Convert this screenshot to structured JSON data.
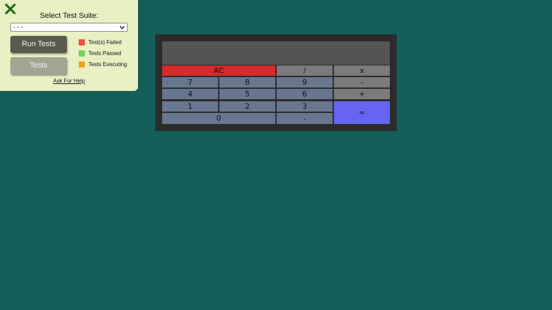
{
  "test_panel": {
    "title": "Select Test Suite:",
    "suite_select": {
      "value": "- - -"
    },
    "run_tests_label": "Run Tests",
    "tests_label": "Tests",
    "legend": [
      {
        "label": "Test(s) Failed",
        "color": "#ee5441"
      },
      {
        "label": "Tests Passed",
        "color": "#6fd45a"
      },
      {
        "label": "Tests Executing",
        "color": "#f5a31a"
      }
    ],
    "help_link": "Ask For Help",
    "close_color": "#1c6b12"
  },
  "calculator": {
    "display": "",
    "keys": {
      "clear": "AC",
      "divide": "/",
      "multiply": "x",
      "subtract": "-",
      "add": "+",
      "equals": "=",
      "seven": "7",
      "eight": "8",
      "nine": "9",
      "four": "4",
      "five": "5",
      "six": "6",
      "one": "1",
      "two": "2",
      "three": "3",
      "zero": "0",
      "decimal": "."
    },
    "colors": {
      "number_key": "#687690",
      "operator_key": "#7b7b7b",
      "clear_key": "#d52b2b",
      "equals_key": "#6764f2"
    }
  }
}
